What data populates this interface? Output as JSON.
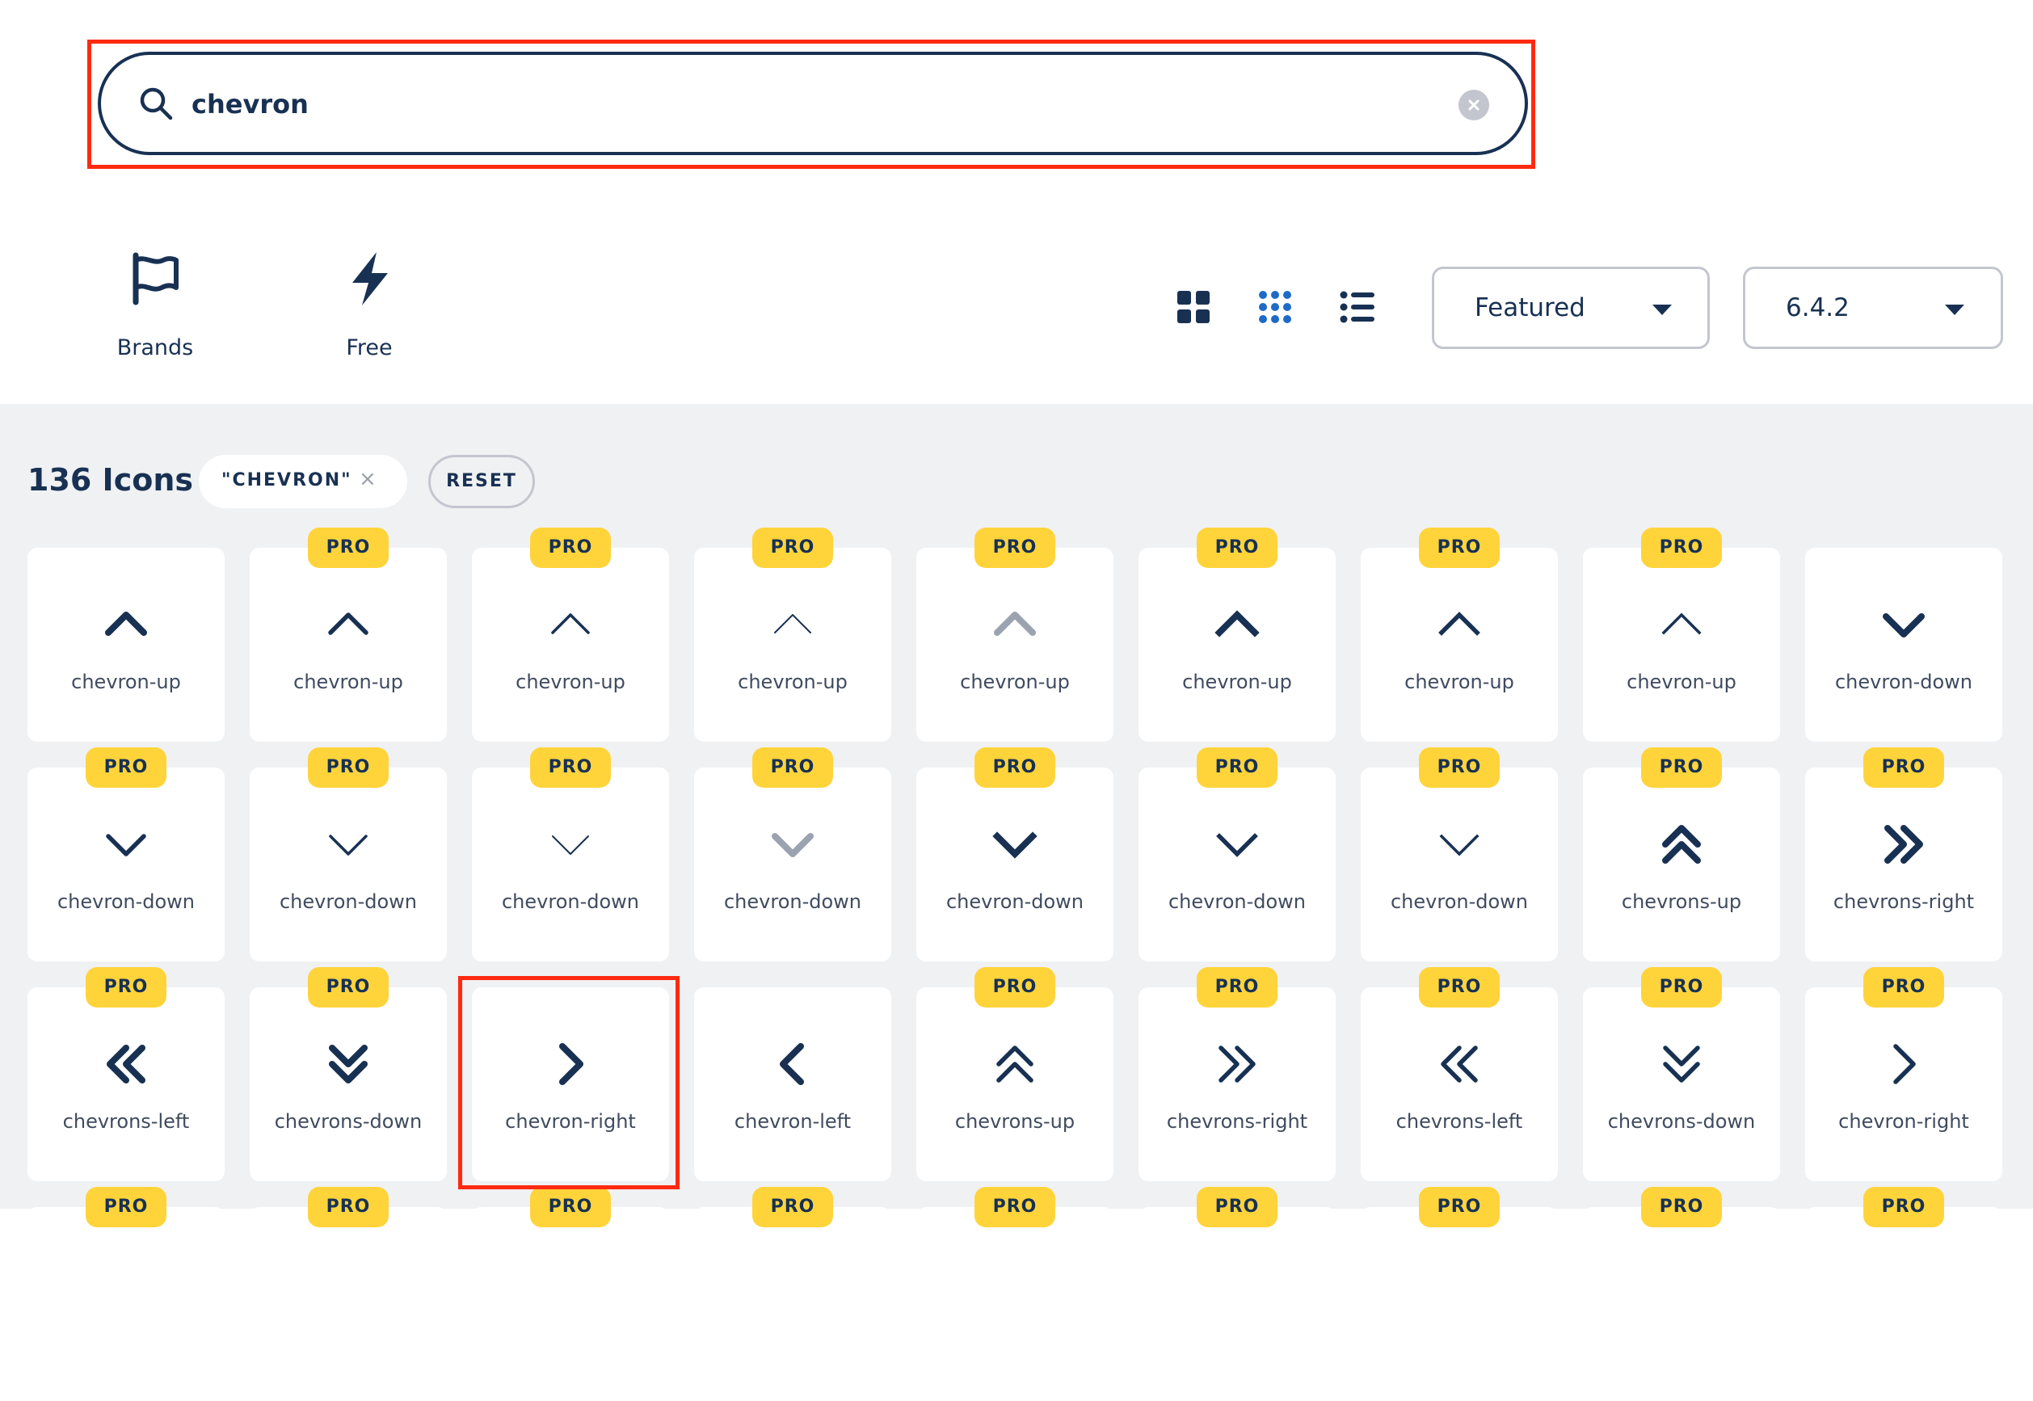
{
  "search": {
    "value": "chevron",
    "placeholder": ""
  },
  "filters": [
    {
      "label": "Brands",
      "icon": "flag-icon"
    },
    {
      "label": "Free",
      "icon": "bolt-icon"
    }
  ],
  "view_modes": [
    "large-grid-icon",
    "small-grid-icon",
    "list-icon"
  ],
  "sort": {
    "value": "Featured"
  },
  "version": {
    "value": "6.4.2"
  },
  "results": {
    "count_label": "136 Icons",
    "query_chip": "\"CHEVRON\"",
    "chip_close": "×",
    "reset_label": "RESET"
  },
  "pro_label": "PRO",
  "colors": {
    "accent": "#ffd43b",
    "highlight": "#ff2a10",
    "text": "#183153",
    "muted": "#9ba3b1"
  },
  "tiles": [
    {
      "name": "chevron-up",
      "pro": false,
      "icon": "chevron-up",
      "style": "solid"
    },
    {
      "name": "chevron-up",
      "pro": true,
      "icon": "chevron-up",
      "style": "regular"
    },
    {
      "name": "chevron-up",
      "pro": true,
      "icon": "chevron-up",
      "style": "light"
    },
    {
      "name": "chevron-up",
      "pro": true,
      "icon": "chevron-up",
      "style": "thin"
    },
    {
      "name": "chevron-up",
      "pro": true,
      "icon": "chevron-up",
      "style": "duotone"
    },
    {
      "name": "chevron-up",
      "pro": true,
      "icon": "chevron-up",
      "style": "sharp-solid"
    },
    {
      "name": "chevron-up",
      "pro": true,
      "icon": "chevron-up",
      "style": "sharp-regular"
    },
    {
      "name": "chevron-up",
      "pro": true,
      "icon": "chevron-up",
      "style": "sharp-light"
    },
    {
      "name": "chevron-down",
      "pro": false,
      "icon": "chevron-down",
      "style": "solid"
    },
    {
      "name": "chevron-down",
      "pro": true,
      "icon": "chevron-down",
      "style": "regular"
    },
    {
      "name": "chevron-down",
      "pro": true,
      "icon": "chevron-down",
      "style": "light"
    },
    {
      "name": "chevron-down",
      "pro": true,
      "icon": "chevron-down",
      "style": "thin"
    },
    {
      "name": "chevron-down",
      "pro": true,
      "icon": "chevron-down",
      "style": "duotone"
    },
    {
      "name": "chevron-down",
      "pro": true,
      "icon": "chevron-down",
      "style": "sharp-solid"
    },
    {
      "name": "chevron-down",
      "pro": true,
      "icon": "chevron-down",
      "style": "sharp-regular"
    },
    {
      "name": "chevron-down",
      "pro": true,
      "icon": "chevron-down",
      "style": "sharp-light"
    },
    {
      "name": "chevrons-up",
      "pro": true,
      "icon": "chevrons-up",
      "style": "solid"
    },
    {
      "name": "chevrons-right",
      "pro": true,
      "icon": "chevrons-right",
      "style": "solid"
    },
    {
      "name": "chevrons-left",
      "pro": true,
      "icon": "chevrons-left",
      "style": "solid"
    },
    {
      "name": "chevrons-down",
      "pro": true,
      "icon": "chevrons-down",
      "style": "solid"
    },
    {
      "name": "chevron-right",
      "pro": false,
      "icon": "chevron-right",
      "style": "solid"
    },
    {
      "name": "chevron-left",
      "pro": false,
      "icon": "chevron-left",
      "style": "solid"
    },
    {
      "name": "chevrons-up",
      "pro": true,
      "icon": "chevrons-up",
      "style": "regular"
    },
    {
      "name": "chevrons-right",
      "pro": true,
      "icon": "chevrons-right",
      "style": "regular"
    },
    {
      "name": "chevrons-left",
      "pro": true,
      "icon": "chevrons-left",
      "style": "regular"
    },
    {
      "name": "chevrons-down",
      "pro": true,
      "icon": "chevrons-down",
      "style": "regular"
    },
    {
      "name": "chevron-right",
      "pro": true,
      "icon": "chevron-right",
      "style": "regular"
    }
  ],
  "next_row_pro": [
    true,
    true,
    true,
    true,
    true,
    true,
    true,
    true,
    true
  ]
}
